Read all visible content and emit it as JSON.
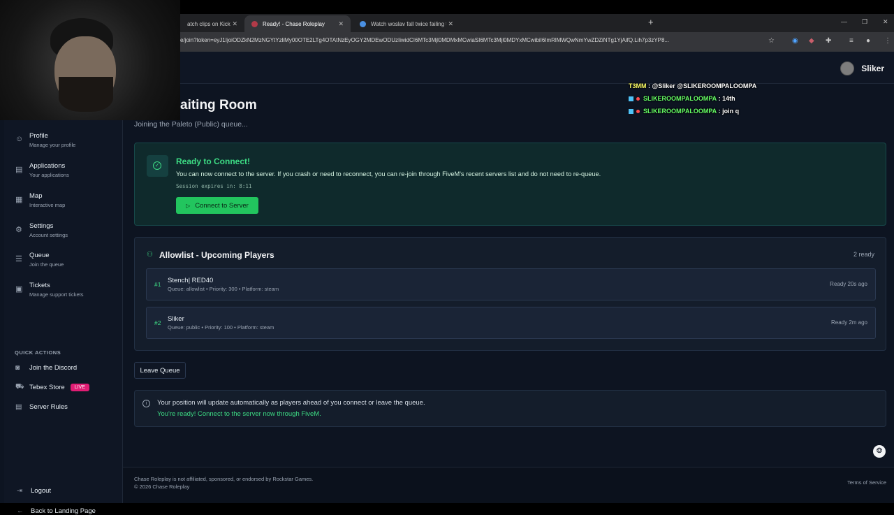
{
  "browser": {
    "tabs": [
      {
        "label": "atch clips on Kick",
        "active": false
      },
      {
        "label": "Ready! - Chase Roleplay",
        "active": true
      },
      {
        "label": "Watch woslav fall twice failing t",
        "active": false
      }
    ],
    "url": "e/join?token=eyJ1IjoiODZkN2MzNGYtYzliMy00OTE2LTg4OTAtNzEyOGY2MDEwODUzIiwidCI6MTc3Mjl0MDMxMCwiaSI6MTc3Mjl0MDYxMCwibiI6ImRlMWQwNmYwZDZiNTg1YjAifQ.Lih7p3zYP8..."
  },
  "header": {
    "username": "Sliker"
  },
  "chat": [
    {
      "user": "T3MM",
      "sep": " : ",
      "message": "@Sliker @SLIKEROOMPALOOMPA"
    },
    {
      "user": "SLIKEROOMPALOOMPA",
      "sep": " : ",
      "message": "14th"
    },
    {
      "user": "SLIKEROOMPALOOMPA",
      "sep": " : ",
      "message": "join q"
    }
  ],
  "sidebar": {
    "items": [
      {
        "label": "Profile",
        "sub": "Manage your profile",
        "icon": "user-icon"
      },
      {
        "label": "Applications",
        "sub": "Your applications",
        "icon": "document-icon"
      },
      {
        "label": "Map",
        "sub": "Interactive map",
        "icon": "map-icon"
      },
      {
        "label": "Settings",
        "sub": "Account settings",
        "icon": "gear-icon"
      },
      {
        "label": "Queue",
        "sub": "Join the queue",
        "icon": "list-icon"
      },
      {
        "label": "Tickets",
        "sub": "Manage support tickets",
        "icon": "ticket-icon"
      }
    ],
    "quick_actions_title": "QUICK ACTIONS",
    "quick_actions": [
      {
        "label": "Join the Discord",
        "icon": "discord-icon"
      },
      {
        "label": "Tebex Store",
        "icon": "cart-icon",
        "badge": "LIVE"
      },
      {
        "label": "Server Rules",
        "icon": "rules-icon"
      }
    ],
    "logout": "Logout",
    "back": "Back to Landing Page"
  },
  "main": {
    "title": "aiting Room",
    "subtitle": "Joining the Paleto (Public) queue...",
    "ready": {
      "heading": "Ready to Connect!",
      "text": "You can now connect to the server. If you crash or need to reconnect, you can re-join through FiveM's recent servers list and do not need to re-queue.",
      "session": "Session expires in: 8:11",
      "button": "Connect to Server"
    },
    "allowlist": {
      "heading": "Allowlist - Upcoming Players",
      "count": "2 ready",
      "rows": [
        {
          "num": "#1",
          "name": "Stench| RED40",
          "meta": "Queue: allowlist • Priority: 300 • Platform: steam",
          "status": "Ready 20s ago"
        },
        {
          "num": "#2",
          "name": "Sliker",
          "meta": "Queue: public • Priority: 100 • Platform: steam",
          "status": "Ready 2m ago"
        }
      ]
    },
    "leave_button": "Leave Queue",
    "info": {
      "line1": "Your position will update automatically as players ahead of you connect or leave the queue.",
      "line2": "You're ready! Connect to the server now through FiveM."
    }
  },
  "footer": {
    "disclaimer": "Chase Roleplay is not affiliated, sponsored, or endorsed by Rockstar Games.",
    "copyright": "© 2026 Chase Roleplay",
    "tos": "Terms of Service"
  },
  "colors": {
    "accent": "#22c55e",
    "background": "#0d1421",
    "live_badge": "#e11d74"
  }
}
